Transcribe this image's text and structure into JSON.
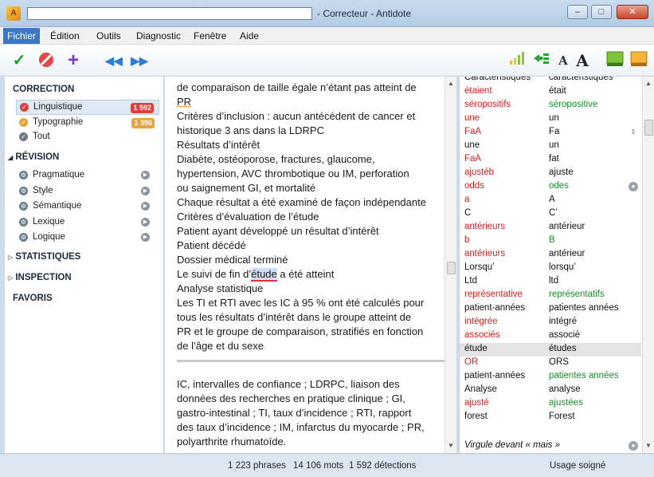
{
  "window": {
    "title": "- Correcteur - Antidote",
    "icon": "antidote-logo-icon"
  },
  "menu": [
    "Fichier",
    "Édition",
    "Outils",
    "Diagnostic",
    "Fenêtre",
    "Aide"
  ],
  "toolbar": {
    "icons": [
      "checkmark-icon",
      "cancel-icon",
      "add-icon",
      "rewind-icon",
      "fast-forward-icon",
      "signal-icon",
      "arrow-list-icon",
      "font-small-icon",
      "font-large-icon",
      "green-book-icon",
      "orange-book-icon"
    ],
    "font_small": "A",
    "font_large": "A"
  },
  "sidebar": {
    "correction_header": "CORRECTION",
    "correction_items": [
      {
        "label": "Linguistique",
        "badge": "1 592",
        "color": "#d9413a"
      },
      {
        "label": "Typographie",
        "badge": "1 396",
        "color": "#e6a43b"
      },
      {
        "label": "Tout",
        "badge": "",
        "color": "#6e7b8c"
      }
    ],
    "revision_header": "RÉVISION",
    "revision_items": [
      "Pragmatique",
      "Style",
      "Sémantique",
      "Lexique",
      "Logique"
    ],
    "other_headers": [
      "STATISTIQUES",
      "INSPECTION",
      "FAVORIS"
    ]
  },
  "document": {
    "lines": [
      "de comparaison de taille égale n’étant pas atteint de",
      "PR",
      "Critères d’inclusion : aucun antécédent de cancer et",
      "historique 3 ans dans la LDRPC",
      "Résultats d’intérêt",
      "Diabète, ostéoporose, fractures, glaucome,",
      "hypertension, AVC thrombotique ou IM, perforation",
      "ou saignement GI, et mortalité",
      "Chaque résultat a été examiné de façon indépendante",
      "Critères d’évaluation de l’étude",
      "Patient ayant développé un résultat d’intérêt",
      "Patient décédé",
      "Dossier médical terminé",
      "Le suivi de fin d’étude a été atteint",
      "Analyse statistique",
      "Les TI et RTI avec les IC à 95 % ont été calculés pour",
      "tous les résultats d’intérêt dans le groupe atteint de",
      "PR et le groupe de comparaison, stratifiés en fonction",
      "de l’âge et du sexe"
    ],
    "footnote_lines": [
      "IC, intervalles de confiance ; LDRPC, liaison des",
      "données des recherches en pratique clinique ; GI,",
      "gastro-intestinal ; TI, taux d’incidence ; RTI, rapport",
      "des taux d’incidence ; IM, infarctus du myocarde ; PR,",
      "polyarthrite rhumatoïde."
    ]
  },
  "corrections": {
    "rows": [
      [
        "Caractéristiques",
        "caractéristiques"
      ],
      [
        "étaient",
        "était"
      ],
      [
        "séropositifs",
        "séropositive"
      ],
      [
        "une",
        "un"
      ],
      [
        "FaA",
        "Fa"
      ],
      [
        "une",
        "un"
      ],
      [
        "FaA",
        "fat"
      ],
      [
        "ajustéb",
        "ajuste"
      ],
      [
        "odds",
        "odes"
      ],
      [
        "a",
        "A"
      ],
      [
        "C",
        "C’"
      ],
      [
        "antérieurs",
        "antérieur"
      ],
      [
        "b",
        "B"
      ],
      [
        "antérieurs",
        "antérieur"
      ],
      [
        "Lorsqu’",
        "lorsqu’"
      ],
      [
        "Ltd",
        "ltd"
      ],
      [
        "représentative",
        "représentatifs"
      ],
      [
        "patient-années",
        "patientes années"
      ],
      [
        "intégrée",
        "intégré"
      ],
      [
        "associés",
        "associé"
      ],
      [
        "étude",
        "études"
      ],
      [
        "OR",
        "ORS"
      ],
      [
        "patient-années",
        "patientes années"
      ],
      [
        "Analyse",
        "analyse"
      ],
      [
        "ajusté",
        "ajustées"
      ],
      [
        "forest",
        "Forest"
      ]
    ],
    "last_row": "Virgule devant « mais »"
  },
  "status": {
    "phrases": "1 223 phrases",
    "mots": "14 106 mots",
    "detections": "1 592 détections",
    "usage": "Usage soigné"
  }
}
